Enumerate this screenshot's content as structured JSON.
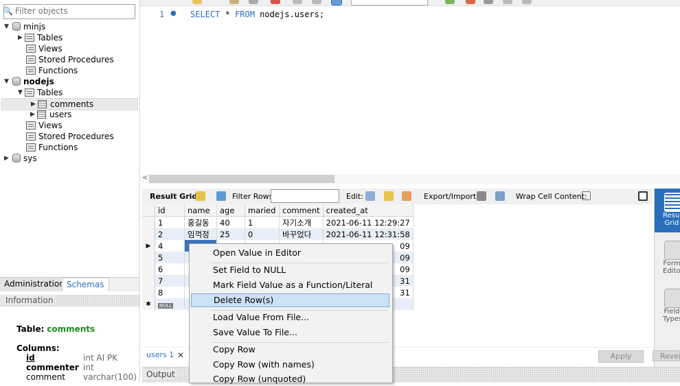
{
  "sidebar": {
    "filter_placeholder": "Filter objects",
    "tree": {
      "minjs": "minjs",
      "minjs_tables": "Tables",
      "minjs_views": "Views",
      "minjs_procs": "Stored Procedures",
      "minjs_funcs": "Functions",
      "nodejs": "nodejs",
      "nodejs_tables": "Tables",
      "comments": "comments",
      "users": "users",
      "nodejs_views": "Views",
      "nodejs_procs": "Stored Procedures",
      "nodejs_funcs": "Functions",
      "sys": "sys"
    },
    "tabs": {
      "administration": "Administration",
      "schemas": "Schemas"
    },
    "information_label": "Information",
    "info": {
      "table_label": "Table:",
      "table_name": "comments",
      "columns_label": "Columns:",
      "columns": [
        {
          "name": "id",
          "type": "int AI PK"
        },
        {
          "name": "commenter",
          "type": "int"
        },
        {
          "name": "comment",
          "type": "varchar(100)"
        }
      ]
    }
  },
  "editor": {
    "line_number": "1",
    "sql": {
      "kw1": "SELECT",
      "star": " * ",
      "kw2": "FROM",
      "rest": " nodejs.users;"
    }
  },
  "result_toolbar": {
    "result_grid": "Result Grid",
    "filter_rows": "Filter Rows:",
    "edit": "Edit:",
    "export_import": "Export/Import:",
    "wrap_cell": "Wrap Cell Content:"
  },
  "grid": {
    "columns": [
      "id",
      "name",
      "age",
      "maried",
      "comment",
      "created_at"
    ],
    "rows": [
      {
        "id": "1",
        "name": "홍길동",
        "age": "40",
        "maried": "1",
        "comment": "자기소개",
        "created_at": "2021-06-11 12:29:27"
      },
      {
        "id": "2",
        "name": "임꺽정",
        "age": "25",
        "maried": "0",
        "comment": "바꾸었다",
        "created_at": "2021-06-11 12:31:58"
      },
      {
        "id": "4",
        "tail": "09"
      },
      {
        "id": "5",
        "tail": "09"
      },
      {
        "id": "6",
        "tail": "09"
      },
      {
        "id": "7",
        "tail": "31"
      },
      {
        "id": "8",
        "tail": "31"
      }
    ],
    "null_badge": "NULL"
  },
  "right_panel": {
    "result_grid": "Result Grid",
    "form_editor": "Form Editor",
    "field_types": "Field Types"
  },
  "context_menu": {
    "open_value": "Open Value in Editor",
    "set_null": "Set Field to NULL",
    "mark_function": "Mark Field Value as a Function/Literal",
    "delete_rows": "Delete Row(s)",
    "load_value": "Load Value From File...",
    "save_value": "Save Value To File...",
    "copy_row": "Copy Row",
    "copy_row_names": "Copy Row (with names)",
    "copy_row_unquoted": "Copy Row (unquoted)"
  },
  "bottom": {
    "tab_users": "users 1",
    "close": "✕",
    "apply": "Apply",
    "revert": "Revert",
    "output": "Output"
  },
  "colors": {
    "accent": "#2a6ebb",
    "selected_cell": "#3b73b9",
    "menu_highlight": "#cde1f5"
  }
}
